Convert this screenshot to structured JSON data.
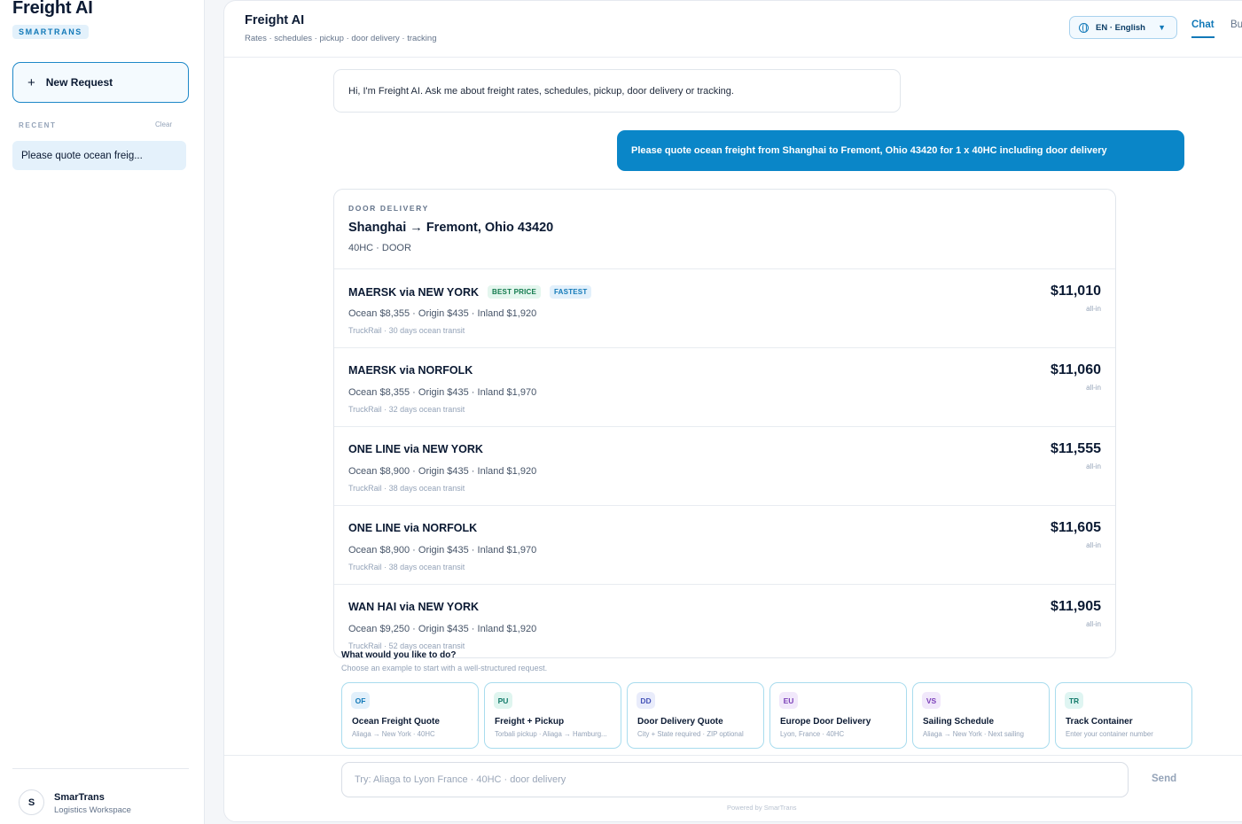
{
  "sidebar": {
    "brand": "Freight AI",
    "badge": "SMARTRANS",
    "new_request": "New Request",
    "new_request_icon": "+",
    "recent_label": "RECENT",
    "clear_label": "Clear",
    "recent_items": [
      "Please quote ocean freig..."
    ],
    "user": {
      "initial": "S",
      "name": "SmarTrans",
      "role": "Logistics Workspace"
    }
  },
  "header": {
    "title": "Freight AI",
    "subtitle": "Rates · schedules · pickup · door delivery · tracking",
    "language": "EN · English",
    "tabs": [
      {
        "label": "Chat",
        "active": true
      },
      {
        "label": "Bu",
        "active": false
      }
    ]
  },
  "messages": {
    "bot": "Hi, I'm Freight AI. Ask me about freight rates, schedules, pickup, door delivery or tracking.",
    "user": "Please quote ocean freight from Shanghai to Fremont, Ohio 43420 for 1 x 40HC including door delivery"
  },
  "quote": {
    "eyebrow": "DOOR DELIVERY",
    "route": "Shanghai → Fremont, Ohio 43420",
    "equipment": "40HC · DOOR",
    "rows": [
      {
        "title": "MAERSK via NEW YORK",
        "tags": [
          "BEST PRICE",
          "FASTEST"
        ],
        "breakdown": "Ocean $8,355 · Origin $435 · Inland $1,920",
        "mode": "TruckRail · 30 days ocean transit",
        "price": "$11,010",
        "allin": "all-in"
      },
      {
        "title": "MAERSK via NORFOLK",
        "tags": [],
        "breakdown": "Ocean $8,355 · Origin $435 · Inland $1,970",
        "mode": "TruckRail · 32 days ocean transit",
        "price": "$11,060",
        "allin": "all-in"
      },
      {
        "title": "ONE LINE via NEW YORK",
        "tags": [],
        "breakdown": "Ocean $8,900 · Origin $435 · Inland $1,920",
        "mode": "TruckRail · 38 days ocean transit",
        "price": "$11,555",
        "allin": "all-in"
      },
      {
        "title": "ONE LINE via NORFOLK",
        "tags": [],
        "breakdown": "Ocean $8,900 · Origin $435 · Inland $1,970",
        "mode": "TruckRail · 38 days ocean transit",
        "price": "$11,605",
        "allin": "all-in"
      },
      {
        "title": "WAN HAI via NEW YORK",
        "tags": [],
        "breakdown": "Ocean $9,250 · Origin $435 · Inland $1,920",
        "mode": "TruckRail · 52 days ocean transit",
        "price": "$11,905",
        "allin": "all-in"
      }
    ]
  },
  "suggestions": {
    "title": "What would you like to do?",
    "subtitle": "Choose an example to start with a well-structured request.",
    "cards": [
      {
        "code": "OF",
        "title": "Ocean Freight Quote",
        "sub": "Aliaga → New York · 40HC",
        "chip_bg": "#e2f0fb",
        "chip_fg": "#1279b8"
      },
      {
        "code": "PU",
        "title": "Freight + Pickup",
        "sub": "Torbali pickup · Aliaga → Hamburg...",
        "chip_bg": "#dff5ef",
        "chip_fg": "#127a6a"
      },
      {
        "code": "DD",
        "title": "Door Delivery Quote",
        "sub": "City + State required · ZIP optional",
        "chip_bg": "#e9ecfb",
        "chip_fg": "#4553b8"
      },
      {
        "code": "EU",
        "title": "Europe Door Delivery",
        "sub": "Lyon, France · 40HC",
        "chip_bg": "#f1e8fb",
        "chip_fg": "#7a3fb8"
      },
      {
        "code": "VS",
        "title": "Sailing Schedule",
        "sub": "Aliaga → New York · Next sailing",
        "chip_bg": "#f1e8fb",
        "chip_fg": "#7a3fb8"
      },
      {
        "code": "TR",
        "title": "Track Container",
        "sub": "Enter your container number",
        "chip_bg": "#dff5f2",
        "chip_fg": "#127a6a"
      }
    ]
  },
  "composer": {
    "placeholder": "Try: Aliaga to Lyon France · 40HC · door delivery",
    "send": "Send",
    "powered_by": "Powered by SmarTrans"
  }
}
